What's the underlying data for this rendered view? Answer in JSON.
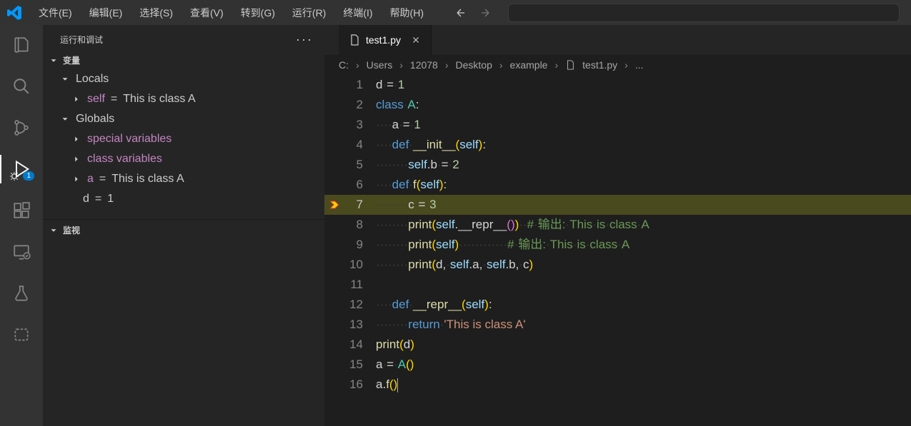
{
  "menu": [
    "文件(E)",
    "编辑(E)",
    "选择(S)",
    "查看(V)",
    "转到(G)",
    "运行(R)",
    "终端(I)",
    "帮助(H)"
  ],
  "activity": {
    "debug_badge": "1"
  },
  "sidebar": {
    "title": "运行和调试",
    "sections": {
      "variables": {
        "label": "变量"
      },
      "watch": {
        "label": "监视"
      }
    },
    "locals_label": "Locals",
    "globals_label": "Globals",
    "locals_self": {
      "name": "self",
      "value": "This is class A"
    },
    "globals_special": "special variables",
    "globals_classvars": "class variables",
    "globals_a": {
      "name": "a",
      "value": "This is class A"
    },
    "globals_d": {
      "name": "d",
      "value": "1"
    }
  },
  "tab": {
    "filename": "test1.py"
  },
  "breadcrumbs": [
    "C:",
    "Users",
    "12078",
    "Desktop",
    "example",
    "test1.py",
    "..."
  ],
  "code": {
    "lines": [
      "1",
      "2",
      "3",
      "4",
      "5",
      "6",
      "7",
      "8",
      "9",
      "10",
      "11",
      "12",
      "13",
      "14",
      "15",
      "16"
    ],
    "l1": {
      "d": "d",
      "eq": "=",
      "n": "1"
    },
    "l2": {
      "kw": "class",
      "cls": "A",
      "col": ":"
    },
    "l3": {
      "a": "a",
      "eq": "=",
      "n": "1"
    },
    "l4": {
      "def": "def",
      "fn": "__init__",
      "p": "(",
      "self": "self",
      "rp": "):"
    },
    "l5": {
      "self": "self",
      "dot": ".b",
      "eq": "=",
      "n": "2"
    },
    "l6": {
      "def": "def",
      "fn": "f",
      "p": "(",
      "self": "self",
      "rp": "):"
    },
    "l7": {
      "c": "c",
      "eq": "=",
      "n": "3"
    },
    "l8": {
      "print": "print",
      "self": "self",
      "repr": ".__repr__",
      "cmt": "输出:",
      "txt": "This is class A"
    },
    "l9": {
      "print": "print",
      "self": "self",
      "cmt": "输出:",
      "txt": "This is class A"
    },
    "l10": {
      "print": "print",
      "d": "d",
      "selfa": "self",
      "a": ".a",
      "selfb": "self",
      "b": ".b",
      "c": "c"
    },
    "l12": {
      "def": "def",
      "fn": "__repr__",
      "p": "(",
      "self": "self",
      "rp": "):"
    },
    "l13": {
      "ret": "return",
      "str": "'This is class A'"
    },
    "l14": {
      "print": "print",
      "d": "d"
    },
    "l15": {
      "a": "a",
      "eq": "=",
      "cls": "A"
    },
    "l16": {
      "a": "a",
      "f": ".f"
    }
  }
}
